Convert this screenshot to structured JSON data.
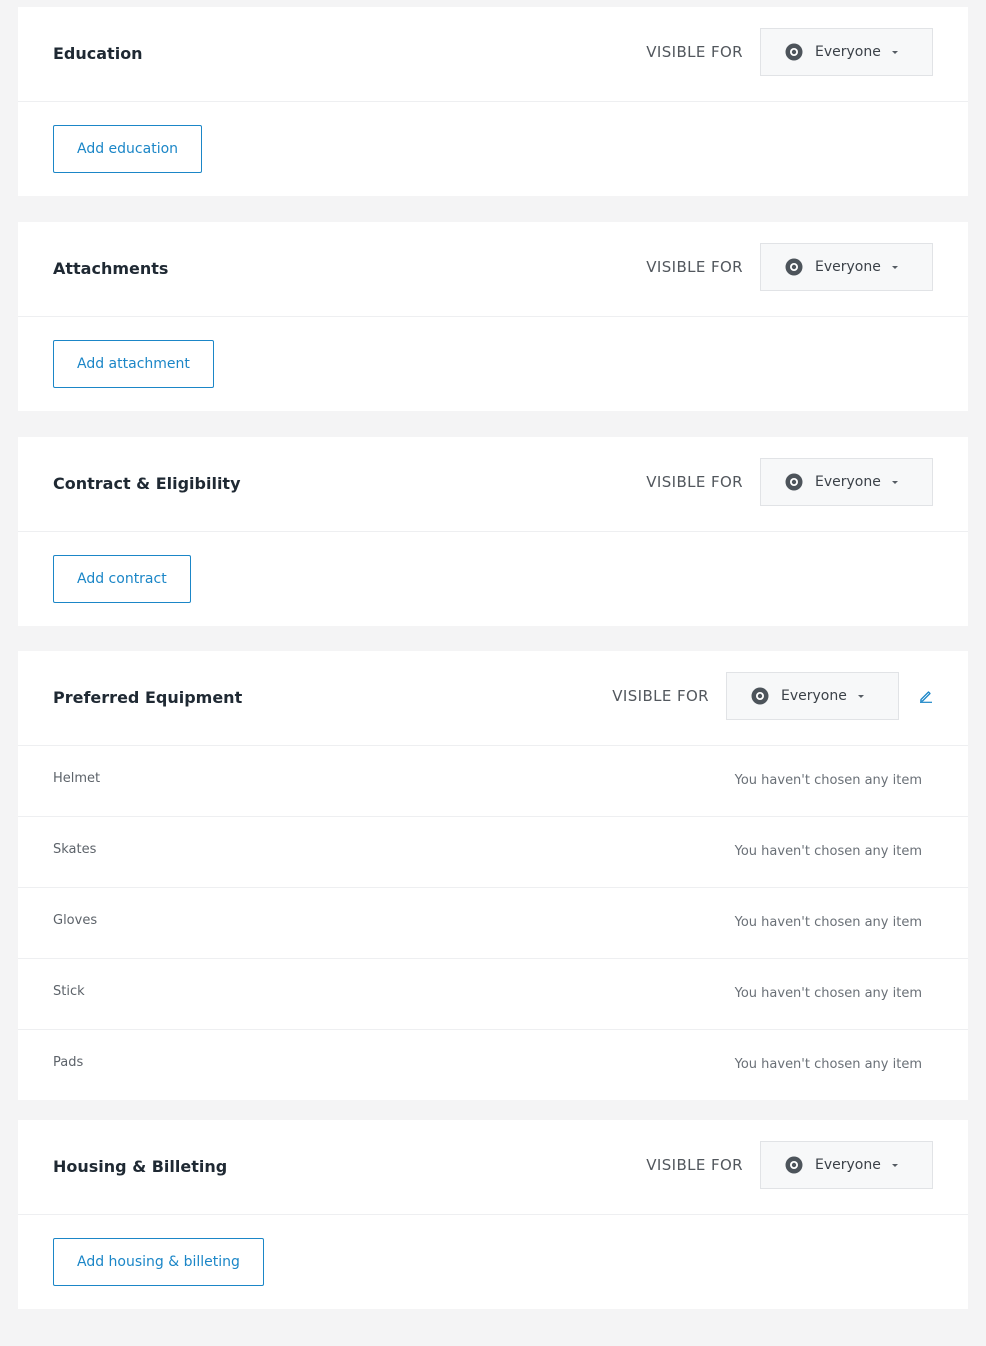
{
  "visible_for_label": "VISIBLE FOR",
  "sections": {
    "education": {
      "title": "Education",
      "visibility": "Everyone",
      "add_label": "Add education"
    },
    "attachments": {
      "title": "Attachments",
      "visibility": "Everyone",
      "add_label": "Add attachment"
    },
    "contract": {
      "title": "Contract & Eligibility",
      "visibility": "Everyone",
      "add_label": "Add contract"
    },
    "equipment": {
      "title": "Preferred Equipment",
      "visibility": "Everyone",
      "items": [
        {
          "name": "Helmet",
          "value": "You haven't chosen any item"
        },
        {
          "name": "Skates",
          "value": "You haven't chosen any item"
        },
        {
          "name": "Gloves",
          "value": "You haven't chosen any item"
        },
        {
          "name": "Stick",
          "value": "You haven't chosen any item"
        },
        {
          "name": "Pads",
          "value": "You haven't chosen any item"
        }
      ]
    },
    "housing": {
      "title": "Housing & Billeting",
      "visibility": "Everyone",
      "add_label": "Add housing & billeting"
    }
  },
  "icons": {
    "visibility": "eye-icon",
    "dropdown": "caret-down-icon",
    "edit": "pencil-icon"
  },
  "colors": {
    "accent": "#1b86c7",
    "page_background": "#f4f4f5",
    "card_background": "#ffffff",
    "select_background": "#f7f8f9"
  }
}
